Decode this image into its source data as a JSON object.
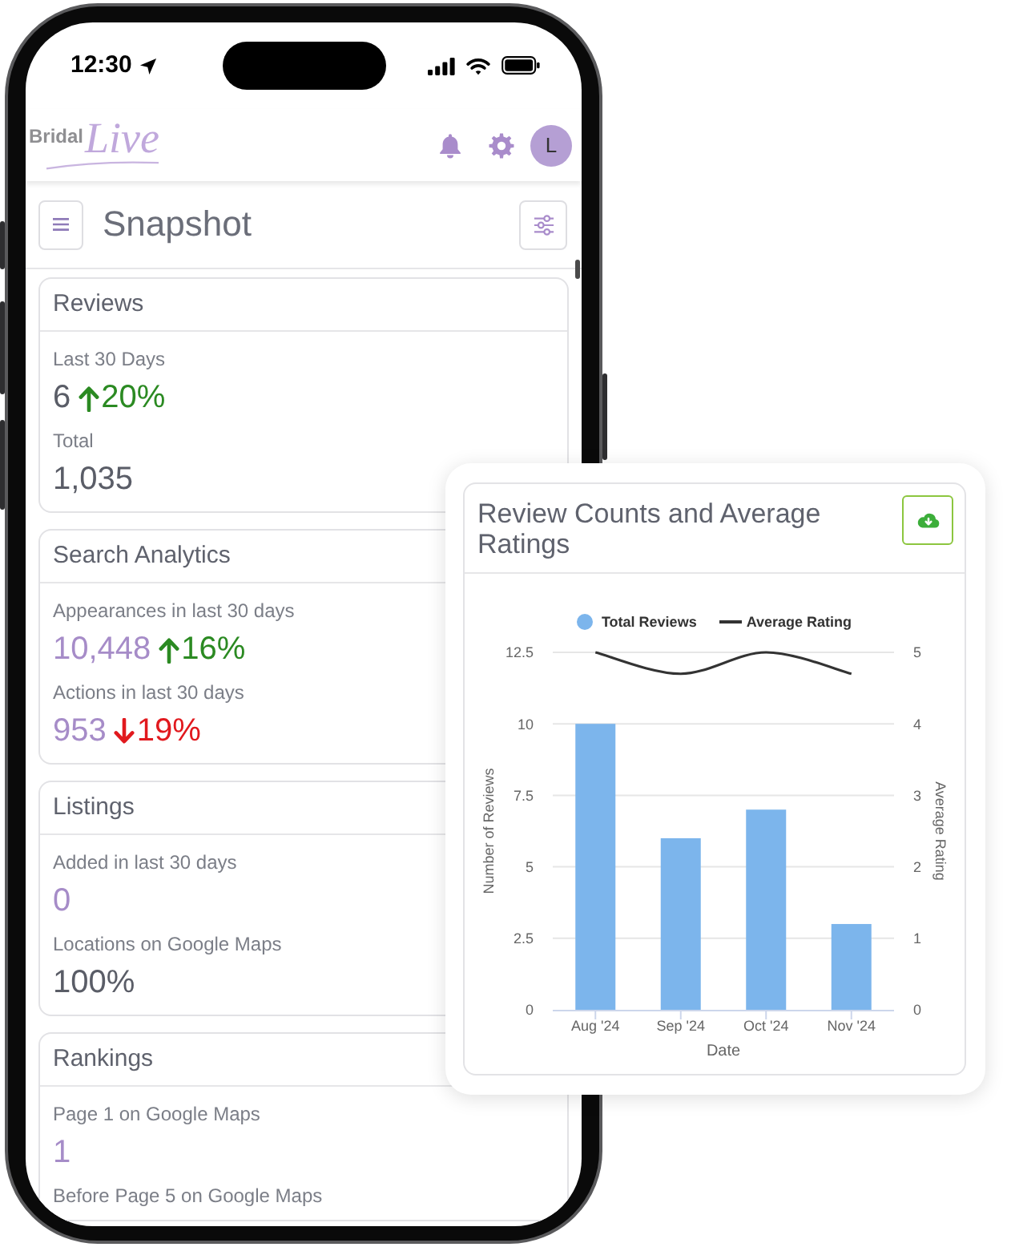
{
  "phone": {
    "status_bar": {
      "time": "12:30"
    },
    "header": {
      "logo": {
        "brand": "Bridal",
        "script": "Live"
      },
      "avatar": "L"
    },
    "toolbar": {
      "title": "Snapshot"
    },
    "cards": [
      {
        "title": "Reviews",
        "stats": [
          {
            "label": "Last 30 Days",
            "value": "6",
            "kind": "plain",
            "change": {
              "kind": "up",
              "text": "20%"
            }
          },
          {
            "label": "Total",
            "value": "1,035",
            "kind": "plain"
          }
        ]
      },
      {
        "title": "Search Analytics",
        "stats": [
          {
            "label": "Appearances in last 30 days",
            "value": "10,448",
            "kind": "accent",
            "change": {
              "kind": "up",
              "text": "16%"
            }
          },
          {
            "label": "Actions in last 30 days",
            "value": "953",
            "kind": "accent",
            "change": {
              "kind": "down",
              "text": "19%"
            }
          }
        ]
      },
      {
        "title": "Listings",
        "stats": [
          {
            "label": "Added in last 30 days",
            "value": "0",
            "kind": "accent"
          },
          {
            "label": "Locations on Google Maps",
            "value": "100%",
            "kind": "plain"
          }
        ]
      },
      {
        "title": "Rankings",
        "stats": [
          {
            "label": "Page 1 on Google Maps",
            "value": "1",
            "kind": "accent"
          },
          {
            "label": "Before Page 5 on Google Maps"
          }
        ]
      }
    ]
  },
  "chart_card": {
    "title": "Review Counts and Average Ratings",
    "chart_data": {
      "type": "bar",
      "xlabel": "Date",
      "ylabel": "Number of Reviews",
      "y2label": "Average Rating",
      "categories": [
        "Aug '24",
        "Sep '24",
        "Oct '24",
        "Nov '24"
      ],
      "series": [
        {
          "name": "Total Reviews",
          "type": "bar",
          "color": "#7cb5ec",
          "values": [
            10,
            6,
            7,
            3
          ]
        },
        {
          "name": "Average Rating",
          "type": "line",
          "axis": "y2",
          "color": "#333333",
          "values": [
            5,
            4.7,
            5,
            4.7
          ]
        }
      ],
      "ylim": [
        0,
        12.5
      ],
      "yticks": [
        {
          "value": 0,
          "label": "0"
        },
        2.5,
        5,
        7.5,
        10,
        12.5
      ],
      "y2lim": [
        0,
        5
      ],
      "y2ticks": [
        {
          "value": 0,
          "label": "0"
        },
        {
          "value": 1,
          "label": "1"
        },
        2,
        3,
        4,
        5
      ],
      "grid": true,
      "legend": true
    }
  }
}
